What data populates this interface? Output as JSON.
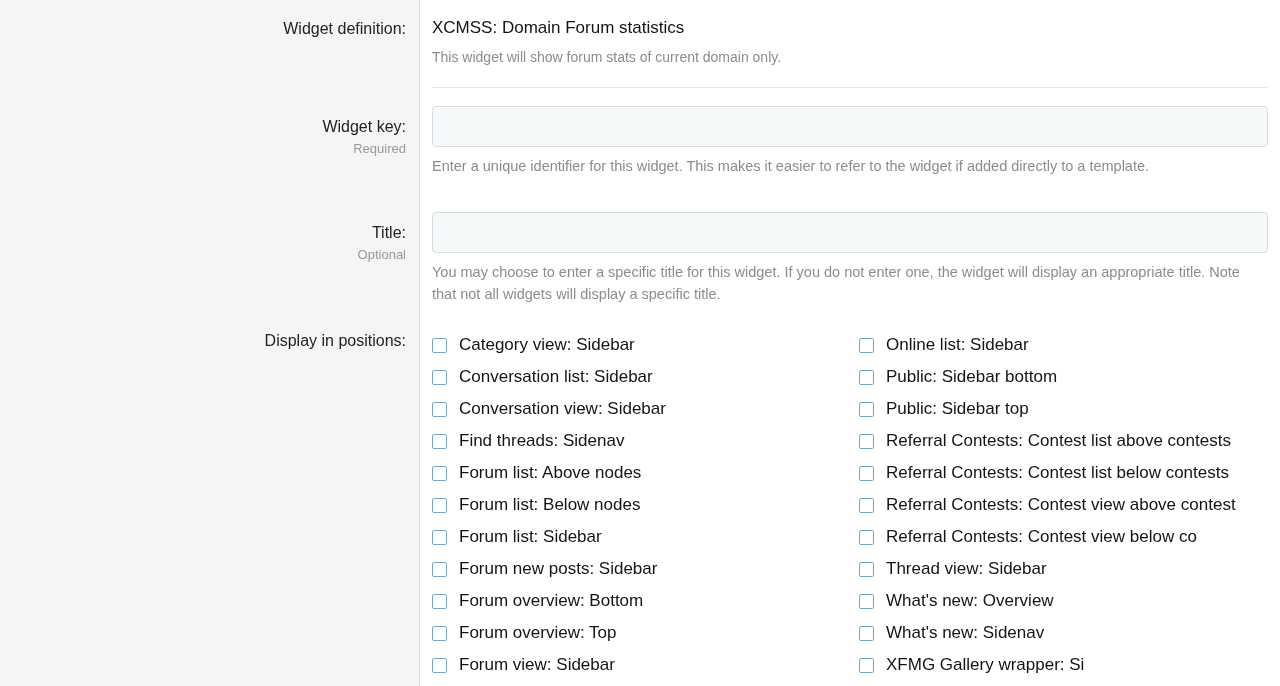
{
  "definition": {
    "label": "Widget definition:",
    "value": "XCMSS: Domain Forum statistics",
    "description": "This widget will show forum stats of current domain only."
  },
  "fields": [
    {
      "label": "Widget key:",
      "note": "Required",
      "hint": "Enter a unique identifier for this widget. This makes it easier to refer to the widget if added directly to a template."
    },
    {
      "label": "Title:",
      "note": "Optional",
      "hint": "You may choose to enter a specific title for this widget. If you do not enter one, the widget will display an appropriate title. Note that not all widgets will display a specific title."
    }
  ],
  "positions": {
    "label": "Display in positions:",
    "columns": [
      [
        {
          "label": "Category view: Sidebar",
          "checked": false
        },
        {
          "label": "Conversation list: Sidebar",
          "checked": false
        },
        {
          "label": "Conversation view: Sidebar",
          "checked": false
        },
        {
          "label": "Find threads: Sidenav",
          "checked": false
        },
        {
          "label": "Forum list: Above nodes",
          "checked": false
        },
        {
          "label": "Forum list: Below nodes",
          "checked": false
        },
        {
          "label": "Forum list: Sidebar",
          "checked": false
        },
        {
          "label": "Forum new posts: Sidebar",
          "checked": false
        },
        {
          "label": "Forum overview: Bottom",
          "checked": false
        },
        {
          "label": "Forum overview: Top",
          "checked": false
        },
        {
          "label": "Forum view: Sidebar",
          "checked": false
        }
      ],
      [
        {
          "label": "Online list: Sidebar",
          "checked": false
        },
        {
          "label": "Public: Sidebar bottom",
          "checked": false
        },
        {
          "label": "Public: Sidebar top",
          "checked": false
        },
        {
          "label": "Referral Contests: Contest list above contests",
          "checked": false
        },
        {
          "label": "Referral Contests: Contest list below contests",
          "checked": false
        },
        {
          "label": "Referral Contests: Contest view above contest",
          "checked": false
        },
        {
          "label": "Referral Contests: Contest view below co",
          "checked": false
        },
        {
          "label": "Thread view: Sidebar",
          "checked": false
        },
        {
          "label": "What's new: Overview",
          "checked": false
        },
        {
          "label": "What's new: Sidenav",
          "checked": false
        },
        {
          "label": "XFMG Gallery wrapper: Si",
          "checked": false
        }
      ]
    ]
  }
}
